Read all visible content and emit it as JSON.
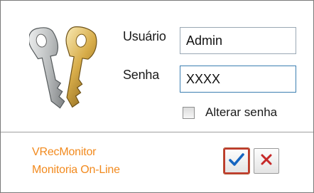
{
  "login": {
    "username_label": "Usuário",
    "username_value": "Admin",
    "password_label": "Senha",
    "password_value": "XXXX",
    "change_password_label": "Alterar senha",
    "change_password_checked": false
  },
  "footer": {
    "app_name": "VRecMonitor",
    "app_subtitle": "Monitoria On-Line",
    "brand_color": "#f28a1e"
  },
  "buttons": {
    "ok_icon": "checkmark-icon",
    "cancel_icon": "close-icon"
  },
  "icons": {
    "keys": "keys-icon"
  }
}
